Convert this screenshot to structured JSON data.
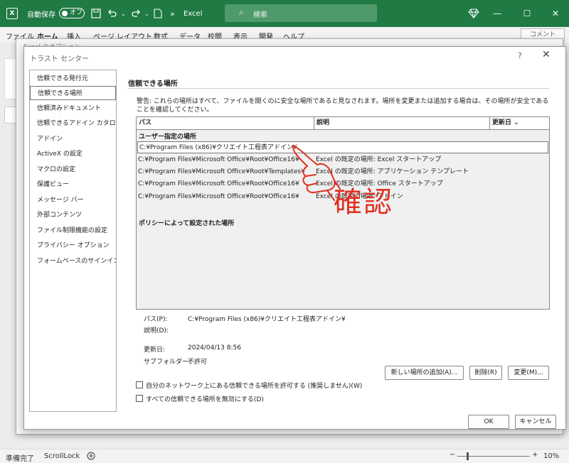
{
  "titlebar": {
    "autosave_label": "自動保存",
    "autosave_state": "オフ",
    "app_name": "Excel",
    "search_placeholder": "検索",
    "excel_logo": "X",
    "expand_icon": "»"
  },
  "menubar": {
    "items": [
      "ファイル",
      "ホーム",
      "挿入",
      "ページ レイアウト",
      "数式",
      "データ",
      "校閲",
      "表示",
      "開発",
      "ヘルプ"
    ],
    "active": "ホーム",
    "comment_label": "コメント"
  },
  "dialog": {
    "back_title": "Excel のオプション",
    "title": "トラスト センター",
    "help": "?",
    "close": "✕",
    "nav": [
      "信頼できる発行元",
      "信頼できる場所",
      "信頼済みドキュメント",
      "信頼できるアドイン カタログ",
      "アドイン",
      "ActiveX の設定",
      "マクロの設定",
      "保護ビュー",
      "メッセージ バー",
      "外部コンテンツ",
      "ファイル制限機能の設定",
      "プライバシー オプション",
      "フォームベースのサインイン"
    ],
    "selected_nav": 1,
    "section_title": "信頼できる場所",
    "warning": "警告: これらの場所はすべて、ファイルを開くのに安全な場所であると見なされます。場所を変更または追加する場合は、その場所が安全であることを確認してください。",
    "grid": {
      "headers": [
        "パス",
        "説明",
        "更新日"
      ],
      "sort_icon": "⌄",
      "user_group": "ユーザー指定の場所",
      "rows": [
        {
          "path": "C:¥Program Files (x86)¥クリエイト工程表アドイン¥",
          "desc": ""
        },
        {
          "path": "C:¥Program Files¥Microsoft Office¥Root¥Office16¥",
          "desc": "Excel の既定の場所: Excel スタートアップ"
        },
        {
          "path": "C:¥Program Files¥Microsoft Office¥Root¥Templates¥",
          "desc": "Excel の既定の場所: アプリケーション テンプレート"
        },
        {
          "path": "C:¥Program Files¥Microsoft Office¥Root¥Office16¥",
          "desc": "Excel の既定の場所: Office スタートアップ"
        },
        {
          "path": "C:¥Program Files¥Microsoft Office¥Root¥Office16¥",
          "desc": "Excel の既定の場所: アドイン"
        }
      ],
      "policy_group": "ポリシーによって設定された場所"
    },
    "details": {
      "path_label": "パス(P):",
      "path_value": "C:¥Program Files (x86)¥クリエイト工程表アドイン¥",
      "desc_label": "説明(D):",
      "updated_label": "更新日:",
      "updated_value": "2024/04/13 8:56",
      "subfolder_label": "サブフォルダー:",
      "subfolder_value": "不許可"
    },
    "buttons": {
      "add": "新しい場所の追加(A)...",
      "remove": "削除(R)",
      "modify": "変更(M)...",
      "ok": "OK",
      "cancel": "キャンセル"
    },
    "checkboxes": [
      {
        "label": "自分のネットワーク上にある信頼できる場所を許可する (推奨しません)(W)",
        "checked": false
      },
      {
        "label": "すべての信頼できる場所を無効にする(D)",
        "checked": false
      }
    ]
  },
  "statusbar": {
    "ready": "準備完了",
    "scrolllock": "ScrollLock",
    "minus": "−",
    "plus": "+",
    "zoom": "10%"
  },
  "annotation": {
    "text": "確認",
    "color": "#e03020"
  }
}
